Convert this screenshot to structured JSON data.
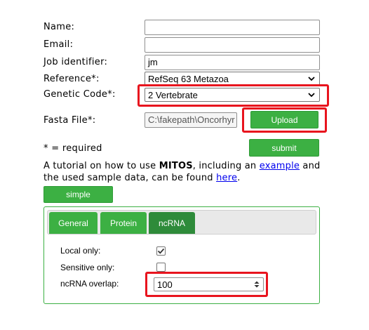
{
  "form": {
    "name_label": "Name:",
    "name_value": "",
    "email_label": "Email:",
    "email_value": "",
    "job_label": "Job identifier:",
    "job_value": "jm",
    "reference_label": "Reference*:",
    "reference_value": "RefSeq 63 Metazoa",
    "genetic_code_label": "Genetic Code*:",
    "genetic_code_value": "2 Vertebrate",
    "fasta_label": "Fasta File*:",
    "fasta_value": "C:\\fakepath\\Oncorhyr",
    "upload_label": "Upload",
    "required_note": "* = required",
    "submit_label": "submit"
  },
  "tutorial": {
    "text_before": "A tutorial on how to use ",
    "app_name": "MITOS",
    "text_middle": ", including an ",
    "example_link": "example",
    "text_after": " and the used sample data, can be found ",
    "here_link": "here",
    "text_end": "."
  },
  "mode_button_label": "simple",
  "tabs": [
    {
      "label": "General"
    },
    {
      "label": "Protein"
    },
    {
      "label": "ncRNA"
    }
  ],
  "ncrna": {
    "local_only_label": "Local only:",
    "local_only_checked": true,
    "sensitive_only_label": "Sensitive only:",
    "sensitive_only_checked": false,
    "overlap_label": "ncRNA overlap:",
    "overlap_value": "100"
  },
  "colors": {
    "accent": "#3cb043",
    "accent_active": "#2e8b3a",
    "highlight": "#e8141e",
    "link": "#0000ee"
  }
}
